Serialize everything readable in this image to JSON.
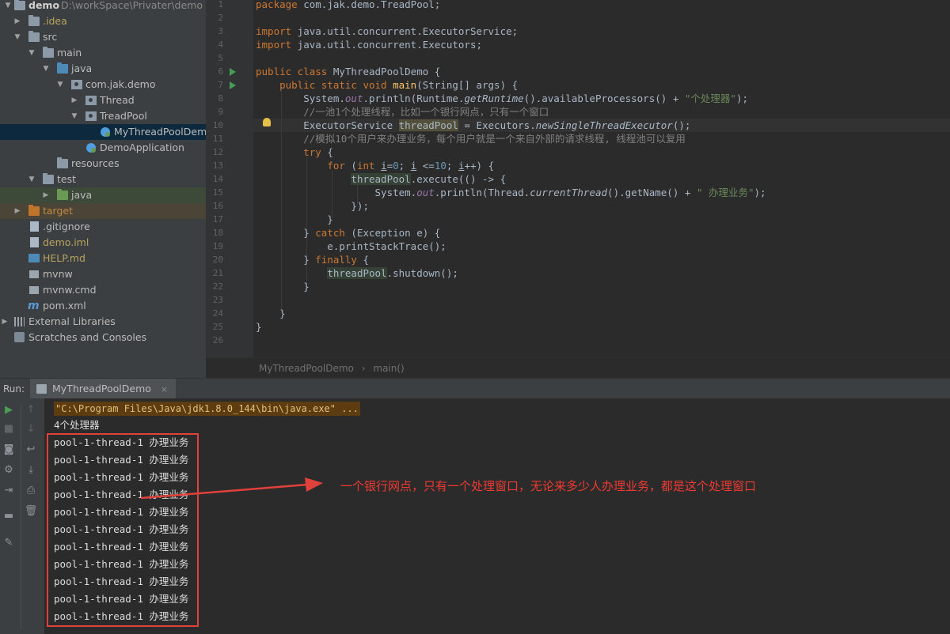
{
  "project_tree": {
    "root": {
      "name": "demo",
      "path": "D:\\workSpace\\Privater\\demo"
    },
    "items": [
      {
        "label": ".idea"
      },
      {
        "label": "src"
      },
      {
        "label": "main"
      },
      {
        "label": "java"
      },
      {
        "label": "com.jak.demo"
      },
      {
        "label": "Thread"
      },
      {
        "label": "TreadPool"
      },
      {
        "label": "MyThreadPoolDemo"
      },
      {
        "label": "DemoApplication"
      },
      {
        "label": "resources"
      },
      {
        "label": "test"
      },
      {
        "label": "java"
      },
      {
        "label": "target"
      },
      {
        "label": ".gitignore"
      },
      {
        "label": "demo.iml"
      },
      {
        "label": "HELP.md"
      },
      {
        "label": "mvnw"
      },
      {
        "label": "mvnw.cmd"
      },
      {
        "label": "pom.xml"
      },
      {
        "label": "External Libraries"
      },
      {
        "label": "Scratches and Consoles"
      }
    ]
  },
  "editor": {
    "line_numbers": [
      "1",
      "2",
      "3",
      "4",
      "5",
      "6",
      "7",
      "8",
      "9",
      "10",
      "11",
      "12",
      "13",
      "14",
      "15",
      "16",
      "17",
      "18",
      "19",
      "20",
      "21",
      "22",
      "23",
      "24",
      "25",
      "26"
    ],
    "breadcrumb": {
      "class": "MyThreadPoolDemo",
      "separator": "›",
      "method": "main()"
    }
  },
  "run_panel": {
    "title": "Run:",
    "tab_label": "MyThreadPoolDemo",
    "tab_close": "×",
    "command": "\"C:\\Program Files\\Java\\jdk1.8.0_144\\bin\\java.exe\" ...",
    "processors_line": "4个处理器",
    "output_lines": [
      "pool-1-thread-1 办理业务",
      "pool-1-thread-1 办理业务",
      "pool-1-thread-1 办理业务",
      "pool-1-thread-1 办理业务",
      "pool-1-thread-1 办理业务",
      "pool-1-thread-1 办理业务",
      "pool-1-thread-1 办理业务",
      "pool-1-thread-1 办理业务",
      "pool-1-thread-1 办理业务",
      "pool-1-thread-1 办理业务",
      "pool-1-thread-1 办理业务"
    ]
  },
  "annotation": {
    "text": "一个银行网点，只有一个处理窗口，无论来多少人办理业务，都是这个处理窗口",
    "color": "#f03a32"
  },
  "colors": {
    "keyword": "#cc7832",
    "string": "#6a8759",
    "number": "#6897bb",
    "comment": "#808080",
    "static_field": "#9876aa",
    "background": "#2b2b2b"
  }
}
